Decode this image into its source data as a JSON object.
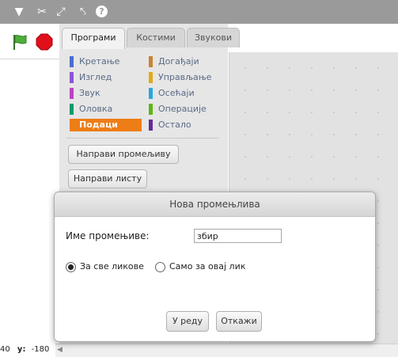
{
  "toolbar": {
    "icons": [
      "stamp-icon",
      "scissors-icon",
      "grow-icon",
      "shrink-icon",
      "help-icon"
    ]
  },
  "coords": {
    "y_label": "y:",
    "x_value": "40",
    "y_value": "-180"
  },
  "tabs": [
    {
      "label": "Програми",
      "active": true
    },
    {
      "label": "Костими",
      "active": false
    },
    {
      "label": "Звукови",
      "active": false
    }
  ],
  "categories": [
    {
      "label": "Кретање",
      "color": "#4a6cd4"
    },
    {
      "label": "Догађаји",
      "color": "#c88330"
    },
    {
      "label": "Изглед",
      "color": "#8a55d7"
    },
    {
      "label": "Управљање",
      "color": "#e1a91a"
    },
    {
      "label": "Звук",
      "color": "#bb42c3"
    },
    {
      "label": "Осећаји",
      "color": "#2ca5e2"
    },
    {
      "label": "Оловка",
      "color": "#0e9a6c"
    },
    {
      "label": "Операције",
      "color": "#5cb712"
    },
    {
      "label": "Подаци",
      "color": "#ee7d16",
      "selected": true
    },
    {
      "label": "Остало",
      "color": "#632d99"
    }
  ],
  "palette_buttons": {
    "make_variable": "Направи промељиву",
    "make_list": "Направи листу"
  },
  "dialog": {
    "title": "Нова промењлива",
    "name_label": "Име промењиве:",
    "name_value": "збир",
    "radio_all": "За све ликове",
    "radio_this": "Само за овај лик",
    "ok": "У реду",
    "cancel": "Откажи"
  }
}
